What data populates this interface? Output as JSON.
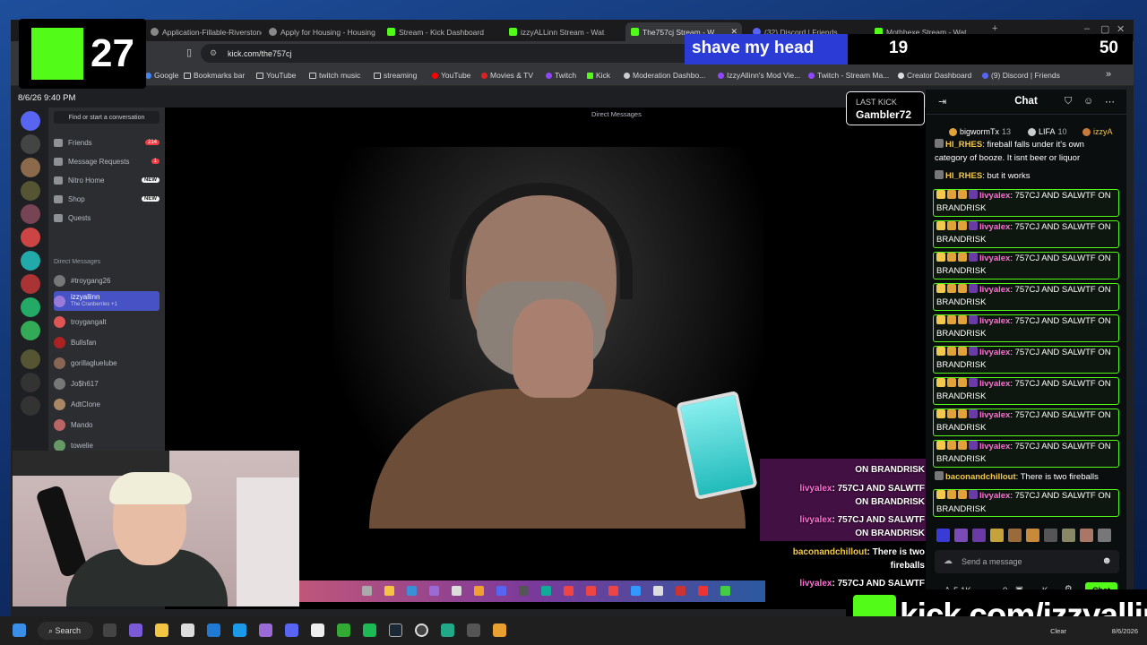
{
  "browser": {
    "tabs": [
      {
        "label": "Application-Fillable-Riverstone"
      },
      {
        "label": "Apply for Housing - Housing"
      },
      {
        "label": "Stream - Kick Dashboard"
      },
      {
        "label": "izzyALLinn Stream - Wat"
      },
      {
        "label": "The757cj Stream - W",
        "active": true
      },
      {
        "label": "(32) Discord | Friends"
      },
      {
        "label": "Mothhexe Stream - Wat"
      }
    ],
    "url": "kick.com/the757cj",
    "bookmarks": [
      "Google",
      "Bookmarks bar",
      "YouTube",
      "twitch music",
      "streaming",
      "YouTube",
      "Movies & TV",
      "Twitch",
      "Kick",
      "Moderation Dashbo...",
      "IzzyAllinn's Mod Vie...",
      "Twitch - Stream Ma...",
      "Creator Dashboard",
      "(9) Discord | Friends"
    ]
  },
  "overlay": {
    "sub_count": "27",
    "goal_title": "shave my head",
    "goal_current": "19",
    "goal_max": "50",
    "goal_progress": 0.38,
    "last_kick_label": "LAST KICK",
    "last_kick_user": "Gambler72",
    "kick_url": "kick.com/izzyallinn",
    "timestamp": "8/6/26 9:40 PM"
  },
  "discord": {
    "title": "Direct Messages",
    "find": "Find or start a conversation",
    "menu": [
      {
        "label": "Friends",
        "badge": "214"
      },
      {
        "label": "Message Requests",
        "badge": "1"
      },
      {
        "label": "Nitro Home",
        "new": "NEW"
      },
      {
        "label": "Shop",
        "new": "NEW"
      },
      {
        "label": "Quests"
      }
    ],
    "dm_header": "Direct Messages",
    "dms": [
      "#troygang26",
      "izzyallinn",
      "troygangalt",
      "Bullsfan",
      "gorillagluelube",
      "Jo$h617",
      "AdtClone",
      "Mando",
      "towelie"
    ],
    "dm_sub": "The Cranberries +1"
  },
  "stream_chat_overlay": [
    {
      "user": "",
      "text": "ON BRANDRISK"
    },
    {
      "user": "livyalex",
      "text": ": 757CJ AND SALWTF"
    },
    {
      "user": "",
      "text": "ON BRANDRISK"
    },
    {
      "user": "livyalex",
      "text": ": 757CJ AND SALWTF"
    },
    {
      "user": "",
      "text": "ON BRANDRISK"
    },
    {
      "user": "baconandchillout",
      "text": ": There is two"
    },
    {
      "user": "",
      "text": "fireballs"
    },
    {
      "user": "livyalex",
      "text": ": 757CJ AND SALWTF"
    },
    {
      "user": "",
      "text": "ON BRANDRISK"
    }
  ],
  "chat": {
    "title": "Chat",
    "gifters": [
      {
        "name": "bigwormTx",
        "count": "13"
      },
      {
        "name": "LIFA",
        "count": "10"
      },
      {
        "name": "izzyA",
        "count": ""
      }
    ],
    "messages": [
      {
        "user": "HI_RHES",
        "text": ": fireball falls under it's own category of booze. It isnt beer or liquor",
        "color": "#f2c94c",
        "hl": false
      },
      {
        "user": "HI_RHES",
        "text": ": but it works",
        "color": "#f2c94c",
        "hl": false
      },
      {
        "user": "livyalex",
        "text": ": 757CJ AND SALWTF ON BRANDRISK",
        "color": "#ff6fd6",
        "hl": true
      },
      {
        "user": "livyalex",
        "text": ": 757CJ AND SALWTF ON BRANDRISK",
        "color": "#ff6fd6",
        "hl": true
      },
      {
        "user": "livyalex",
        "text": ": 757CJ AND SALWTF ON BRANDRISK",
        "color": "#ff6fd6",
        "hl": true
      },
      {
        "user": "livyalex",
        "text": ": 757CJ AND SALWTF ON BRANDRISK",
        "color": "#ff6fd6",
        "hl": true
      },
      {
        "user": "livyalex",
        "text": ": 757CJ AND SALWTF ON BRANDRISK",
        "color": "#ff6fd6",
        "hl": true
      },
      {
        "user": "livyalex",
        "text": ": 757CJ AND SALWTF ON BRANDRISK",
        "color": "#ff6fd6",
        "hl": true
      },
      {
        "user": "livyalex",
        "text": ": 757CJ AND SALWTF ON BRANDRISK",
        "color": "#ff6fd6",
        "hl": true
      },
      {
        "user": "livyalex",
        "text": ": 757CJ AND SALWTF ON BRANDRISK",
        "color": "#ff6fd6",
        "hl": true
      },
      {
        "user": "livyalex",
        "text": ": 757CJ AND SALWTF ON BRANDRISK",
        "color": "#ff6fd6",
        "hl": true
      },
      {
        "user": "baconandchillout",
        "text": ": There is two fireballs",
        "color": "#f2c94c",
        "hl": false
      },
      {
        "user": "livyalex",
        "text": ": 757CJ AND SALWTF ON BRANDRISK",
        "color": "#ff6fd6",
        "hl": true
      }
    ],
    "placeholder": "Send a message",
    "viewers": "5.1K",
    "count": "0",
    "k_label": "K",
    "send_label": "Chat"
  },
  "taskbar": {
    "search": "Search",
    "clock_status": "Clear",
    "date": "8/6/2026"
  },
  "colors": {
    "kick_green": "#53fc18",
    "goal_blue": "#2a3bd6"
  }
}
